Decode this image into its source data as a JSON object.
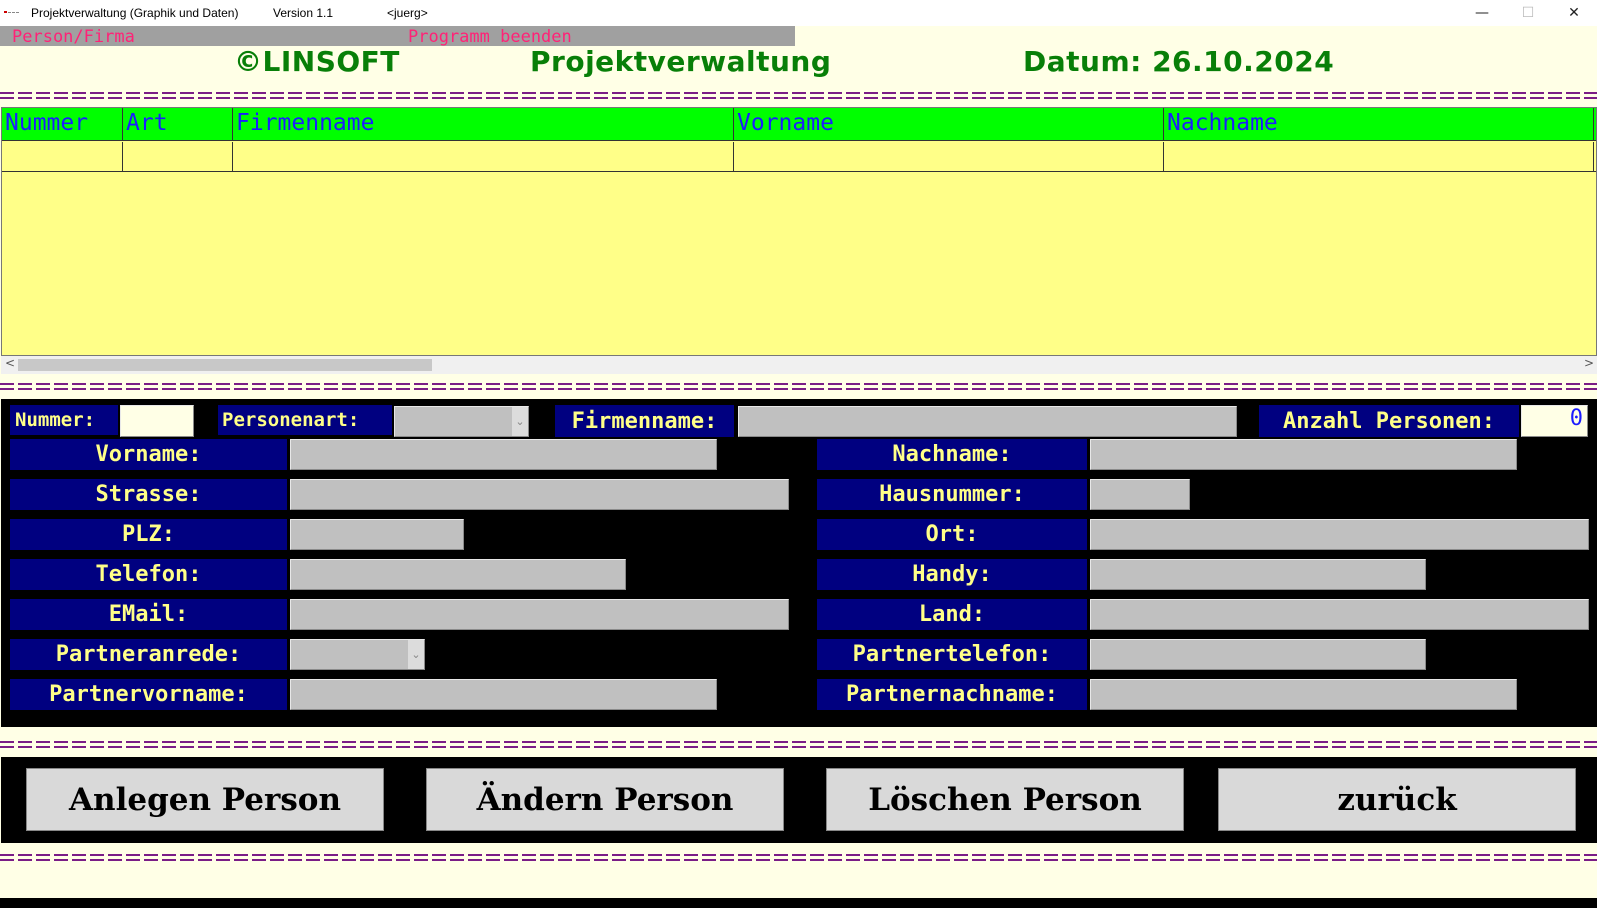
{
  "window": {
    "title": "Projektverwaltung (Graphik und Daten)",
    "version": "Version 1.1",
    "user": "<juerg>",
    "minimize": "—",
    "maximize": "☐",
    "close": "✕"
  },
  "menu": {
    "person_firma": "Person/Firma",
    "programm_beenden": "Programm beenden"
  },
  "header": {
    "brand": "©LINSOFT",
    "title": "Projektverwaltung",
    "date": "Datum: 26.10.2024"
  },
  "grid": {
    "columns": [
      "Nummer",
      "Art",
      "Firmenname",
      "Vorname",
      "Nachname"
    ]
  },
  "form": {
    "nummer_label": "Nummer:",
    "nummer_value": "",
    "personenart_label": "Personenart:",
    "personenart_value": "",
    "firmenname_label": "Firmenname:",
    "anzahl_label": "Anzahl Personen:",
    "anzahl_value": "0",
    "vorname_label": "Vorname:",
    "nachname_label": "Nachname:",
    "strasse_label": "Strasse:",
    "hausnummer_label": "Hausnummer:",
    "plz_label": "PLZ:",
    "ort_label": "Ort:",
    "telefon_label": "Telefon:",
    "handy_label": "Handy:",
    "email_label": "EMail:",
    "land_label": "Land:",
    "partneranrede_label": "Partneranrede:",
    "partnertelefon_label": "Partnertelefon:",
    "partnervorname_label": "Partnervorname:",
    "partnernachname_label": "Partnernachname:"
  },
  "buttons": {
    "anlegen": "Anlegen Person",
    "aendern": "Ändern Person",
    "loeschen": "Löschen Person",
    "zurueck": "zurück"
  },
  "icons": {
    "app_icon": "app-icon",
    "combo": "chevron-down-icon",
    "scroll_left": "chevron-left-icon",
    "scroll_right": "chevron-right-icon"
  },
  "colors": {
    "header_green": "#087f08",
    "grid_head": "#00ff00",
    "grid_body": "#ffff88",
    "label_bg": "#000080",
    "label_text": "#ffff88",
    "menu_text": "#ff2277",
    "separator": "#7a1d86"
  }
}
